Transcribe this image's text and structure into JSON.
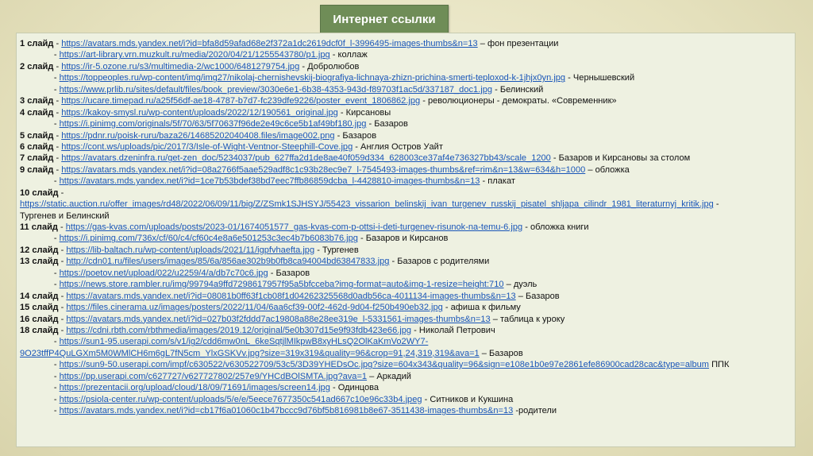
{
  "title": "Интернет ссылки",
  "rows": [
    {
      "label": "1 слайд",
      "indent": false,
      "url": "https://avatars.mds.yandex.net/i?id=bfa8d59afad68e2f372a1dc2619dcf0f_l-3996495-images-thumbs&n=13",
      "desc": "– фон презентации"
    },
    {
      "label": "",
      "indent": true,
      "url": "https://art-library.vrn.muzkult.ru/media/2020/04/21/1255543780/p1.jpg",
      "desc": "- коллаж"
    },
    {
      "label": "2 слайд",
      "indent": false,
      "url": "https://ir-5.ozone.ru/s3/multimedia-2/wc1000/6481279754.jpg",
      "desc": "- Добролюбов"
    },
    {
      "label": "",
      "indent": true,
      "url": "https://toppeoples.ru/wp-content/img/img27/nikolaj-chernishevskij-biografiya-lichnaya-zhizn-prichina-smerti-teploxod-k-1jhjx0yn.jpg",
      "desc": "- Чернышевский"
    },
    {
      "label": "",
      "indent": true,
      "url": "https://www.prlib.ru/sites/default/files/book_preview/3030e6e1-6b38-4353-943d-f89703f1ac5d/337187_doc1.jpg",
      "desc": "- Белинский"
    },
    {
      "label": "3 слайд",
      "indent": false,
      "url": "https://ucare.timepad.ru/a25f56df-ae18-4787-b7d7-fc239dfe9226/poster_event_1806862.jpg",
      "desc": "- революционеры - демократы. «Современник»"
    },
    {
      "label": "4 слайд",
      "indent": false,
      "url": "https://kakoy-smysl.ru/wp-content/uploads/2022/12/190561_original.jpg",
      "desc": "- Кирсановы"
    },
    {
      "label": "",
      "indent": true,
      "url": "https://i.pinimg.com/originals/5f/70/63/5f70637f96de2e49c6ce5b1af49bf180.jpg",
      "desc": "- Базаров"
    },
    {
      "label": "5 слайд",
      "indent": false,
      "url": "https://pdnr.ru/poisk-ruru/baza26/14685202040408.files/image002.png",
      "desc": "- Базаров"
    },
    {
      "label": "6 слайд",
      "indent": false,
      "url": "https://cont.ws/uploads/pic/2017/3/Isle-of-Wight-Ventnor-Steephill-Cove.jpg",
      "desc": "- Англия Остров Уайт"
    },
    {
      "label": "7 слайд",
      "indent": false,
      "url": "https://avatars.dzeninfra.ru/get-zen_doc/5234037/pub_627ffa2d1de8ae40f059d334_628003ce37af4e736327bb43/scale_1200",
      "desc": "- Базаров и Кирсановы за столом"
    },
    {
      "label": "9 слайд",
      "indent": false,
      "url": "https://avatars.mds.yandex.net/i?id=08a2766f5aae529adf8c1c93b28ec9e7_l-7545493-images-thumbs&ref=rim&n=13&w=634&h=1000",
      "desc": "– обложка"
    },
    {
      "label": "",
      "indent": true,
      "url": "https://avatars.mds.yandex.net/i?id=1ce7b53bdef38bd7eec7ffb86859dcba_l-4428810-images-thumbs&n=13",
      "desc": " - плакат"
    },
    {
      "label": "10 слайд",
      "indent": false,
      "url": "",
      "desc": ""
    },
    {
      "label": "",
      "indent": false,
      "url": "https://static.auction.ru/offer_images/rd48/2022/06/09/11/big/Z/ZSmk1SJHSYJ/55423_vissarion_belinskij_ivan_turgenev_russkij_pisatel_shljapa_cilindr_1981_literaturnyj_kritik.jpg",
      "desc": "-"
    },
    {
      "label": "",
      "indent": false,
      "url": "",
      "desc": "Тургенев и Белинский"
    },
    {
      "label": "11 слайд",
      "indent": false,
      "url": "https://gas-kvas.com/uploads/posts/2023-01/1674051577_gas-kvas-com-p-ottsi-i-deti-turgenev-risunok-na-temu-6.jpg",
      "desc": "- обложка книги"
    },
    {
      "label": "",
      "indent": true,
      "url": "https://i.pinimg.com/736x/cf/60/c4/cf60c4e8a6e501253c3ec4b7b6083b76.jpg",
      "desc": "- Базаров и Кирсанов"
    },
    {
      "label": "12 слайд",
      "indent": false,
      "url": "https://lib-baltach.ru/wp-content/uploads/2021/11/igpfvhaefta.jpg",
      "desc": "- Тургенев"
    },
    {
      "label": "13 слайд",
      "indent": false,
      "url": "http://cdn01.ru/files/users/images/85/6a/856ae302b9b0fb8ca94004bd63847833.jpg",
      "desc": "- Базаров с родителями"
    },
    {
      "label": "",
      "indent": true,
      "url": "https://poetov.net/upload/022/u2259/4/a/db7c70c6.jpg",
      "desc": "- Базаров"
    },
    {
      "label": "",
      "indent": true,
      "url": "https://news.store.rambler.ru/img/99794a9ffd7298617957f95a5bfcceba?img-format=auto&img-1-resize=height:710",
      "desc": "– дуэль"
    },
    {
      "label": "14 слайд",
      "indent": false,
      "url": "https://avatars.mds.yandex.net/i?id=08081b0ff63f1cb08f1d04262325568d0adb56ca-4011134-images-thumbs&n=13",
      "desc": "– Базаров"
    },
    {
      "label": "15 слайд",
      "indent": false,
      "url": "https://files.cinerama.uz/images/posters/2022/11/04/6aa6cf39-00f2-462d-9d04-f250b490eb32.jpg",
      "desc": "- афиша к фильму"
    },
    {
      "label": "16 слайд",
      "indent": false,
      "url": "https://avatars.mds.yandex.net/i?id=027b03f2fddd7ac19808a88e28ee319e_l-5331561-images-thumbs&n=13",
      "desc": "– таблица к уроку"
    },
    {
      "label": "18 слайд",
      "indent": false,
      "url": "https://cdni.rbth.com/rbthmedia/images/2019.12/original/5e0b307d15e9f93fdb423e66.jpg",
      "desc": "- Николай Петрович"
    },
    {
      "label": "",
      "indent": true,
      "url": "https://sun1-95.userapi.com/s/v1/ig2/cdd6mw0nL_6keSqtjlMIkpwB8xyHLsQ2OlKaKmVo2WY7-",
      "desc": ""
    },
    {
      "label": "",
      "indent": false,
      "url": "9O23tffP4QuLGXm5M0WMlCH6m6gL7fN5cm_YlxGSKVv.jpg?size=319x319&quality=96&crop=91,24,319,319&ava=1",
      "desc": "– Базаров"
    },
    {
      "label": "",
      "indent": true,
      "url": "https://sun9-50.userapi.com/impf/c630522/v630522709/53c5/3D39YHEDsOc.jpg?size=604x343&quality=96&sign=e108e1b0e97e2861efe86900cad28cac&type=album",
      "desc": "ППК"
    },
    {
      "label": "",
      "indent": true,
      "url": "https://pp.userapi.com/c627727/v627727802/257e9/YHCdBOlSMTA.jpg?ava=1",
      "desc": "– Аркадий"
    },
    {
      "label": "",
      "indent": true,
      "url": "https://prezentacii.org/upload/cloud/18/09/71691/images/screen14.jpg",
      "desc": "- Одинцова"
    },
    {
      "label": "",
      "indent": true,
      "url": "https://psiola-center.ru/wp-content/uploads/5/e/e/5eece7677350c541ad667c10e96c33b4.jpeg",
      "desc": "- Ситников и Кукшина"
    },
    {
      "label": "",
      "indent": true,
      "url": "https://avatars.mds.yandex.net/i?id=cb17f6a01060c1b47bccc9d76bf5b816981b8e67-3511438-images-thumbs&n=13",
      "desc": "-родители"
    }
  ]
}
